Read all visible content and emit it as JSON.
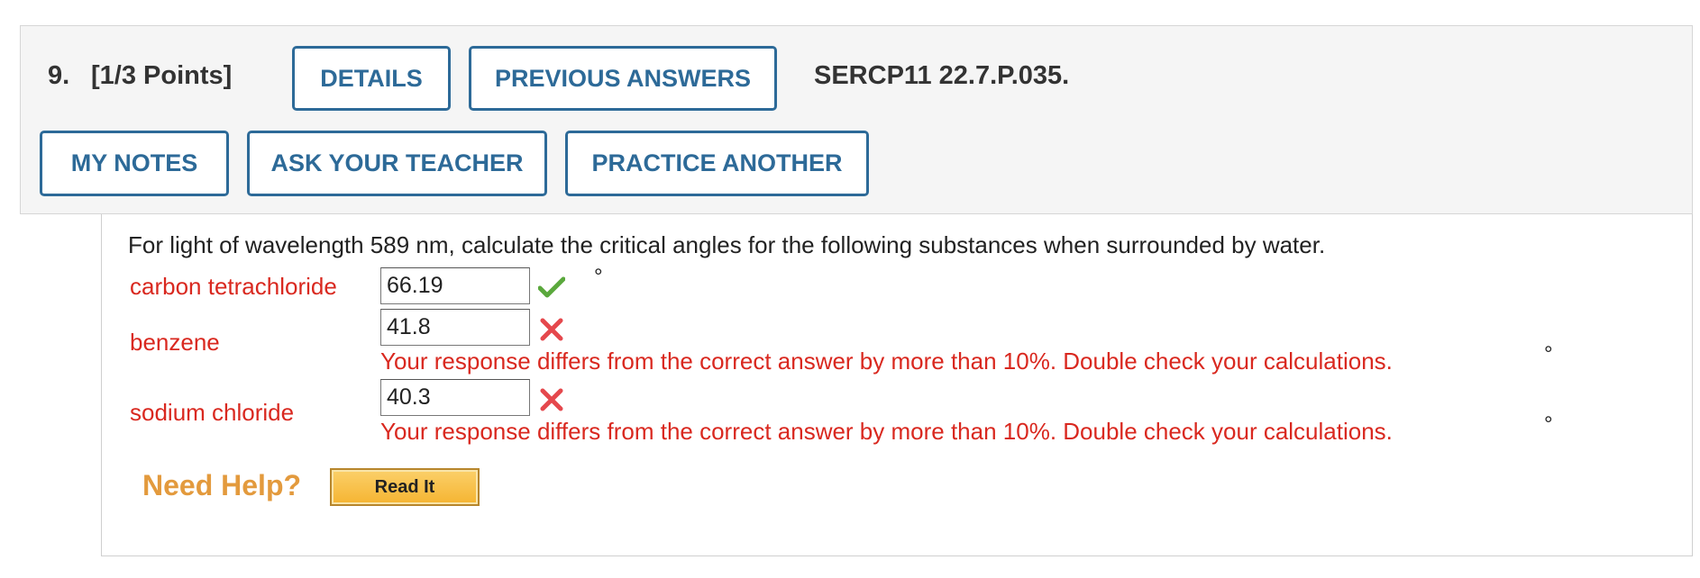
{
  "header": {
    "question_number": "9.",
    "points": "[1/3 Points]",
    "question_id": "SERCP11 22.7.P.035.",
    "buttons": {
      "details": "DETAILS",
      "previous_answers": "PREVIOUS ANSWERS",
      "my_notes": "MY NOTES",
      "ask_teacher": "ASK YOUR TEACHER",
      "practice_another": "PRACTICE ANOTHER"
    }
  },
  "question": {
    "text": "For light of wavelength 589 nm, calculate the critical angles for the following substances when surrounded by water.",
    "unit": "°",
    "parts": [
      {
        "label": "carbon tetrachloride",
        "value": "66.19",
        "status": "correct",
        "feedback": ""
      },
      {
        "label": "benzene",
        "value": "41.8",
        "status": "incorrect",
        "feedback": "Your response differs from the correct answer by more than 10%. Double check your calculations."
      },
      {
        "label": "sodium chloride",
        "value": "40.3",
        "status": "incorrect",
        "feedback": "Your response differs from the correct answer by more than 10%. Double check your calculations."
      }
    ]
  },
  "help": {
    "label": "Need Help?",
    "read_it": "Read It"
  },
  "colors": {
    "accent": "#2d6a98",
    "error": "#d9281f",
    "correct": "#5aa83c",
    "help_label": "#e39a3d"
  },
  "icons": {
    "correct": "check-icon",
    "incorrect": "x-icon"
  }
}
